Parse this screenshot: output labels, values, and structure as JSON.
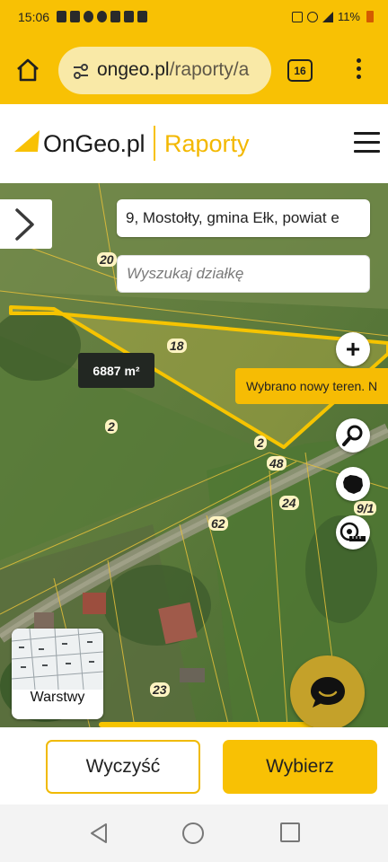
{
  "status_bar": {
    "time": "15:06",
    "battery": "11%"
  },
  "browser": {
    "domain": "ongeo.pl",
    "path": "/raporty/a",
    "tab_count": "16"
  },
  "site": {
    "logo": "OnGeo.pl",
    "section": "Raporty"
  },
  "map": {
    "address": "9, Mostołty, gmina Ełk, powiat e",
    "search_placeholder": "Wyszukaj działkę",
    "area": "6887 m²",
    "toast": "Wybrano nowy teren. N",
    "layers_label": "Warstwy",
    "parcel_labels": [
      "20",
      "18",
      "2",
      "2",
      "48",
      "24",
      "9/1",
      "62",
      "23"
    ]
  },
  "actions": {
    "clear_label": "Wyczyść",
    "select_label": "Wybierz"
  },
  "colors": {
    "accent": "#f8c104",
    "parcel_outline": "#f6c400"
  }
}
